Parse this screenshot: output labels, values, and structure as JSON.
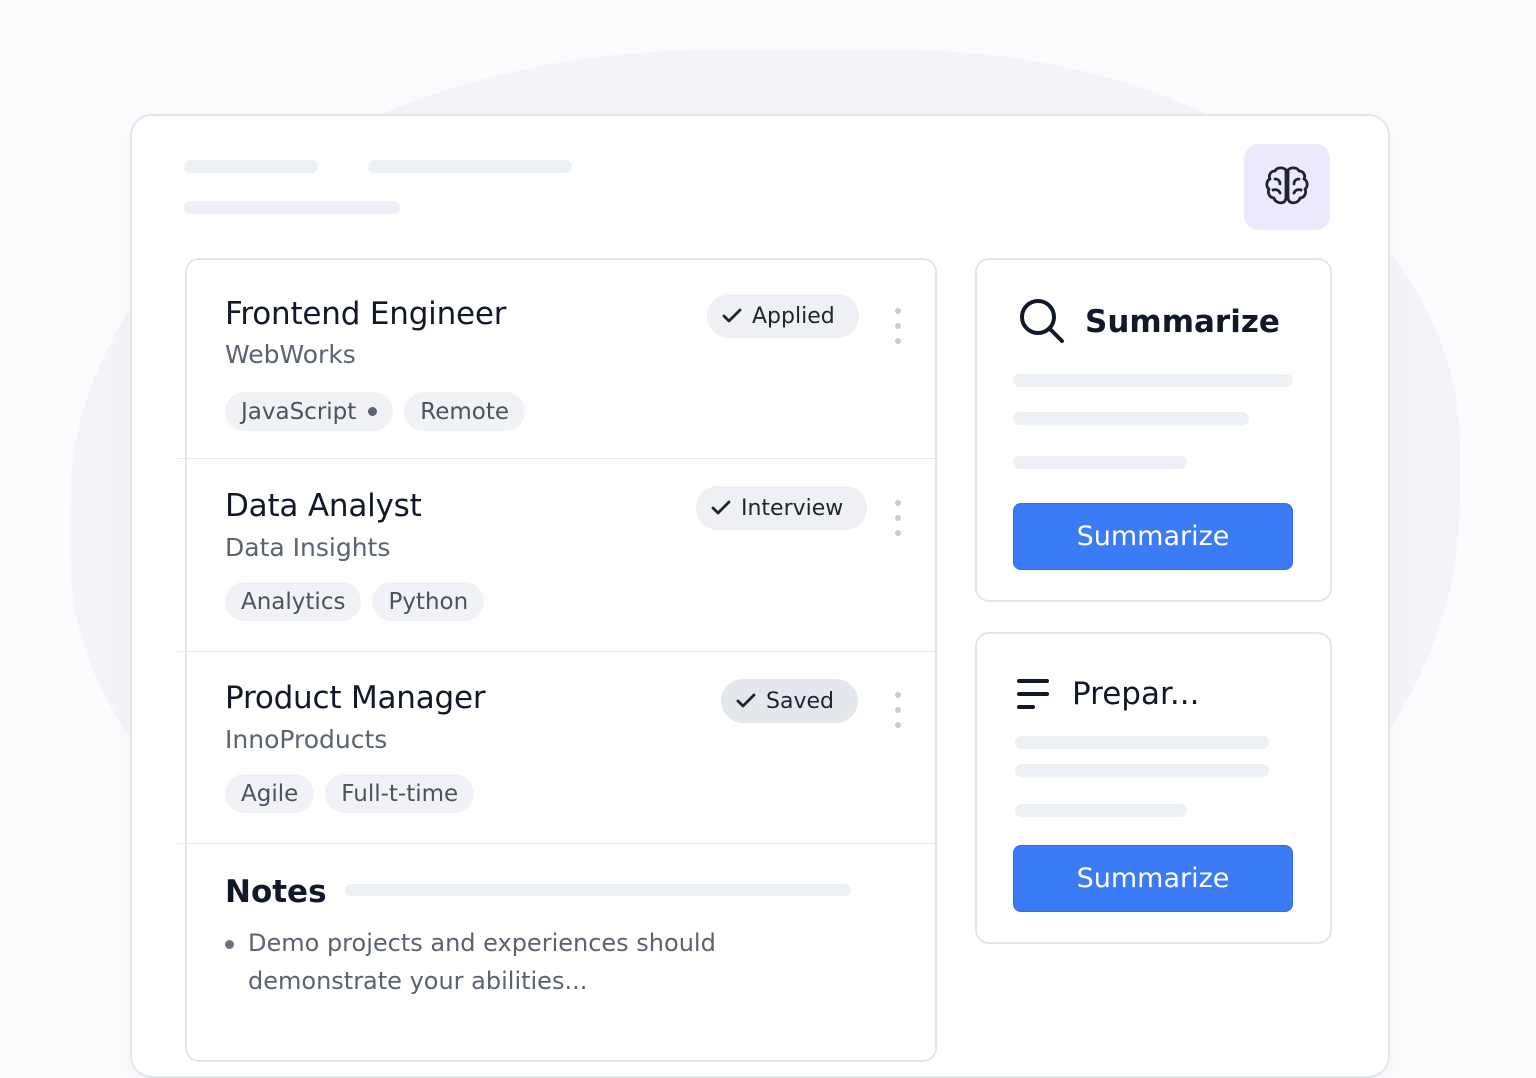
{
  "header": {
    "ai_button_icon": "brain-icon"
  },
  "jobs": [
    {
      "title": "Frontend Engineer",
      "company": "WebWorks",
      "status": "Applied",
      "status_icon": "check-icon",
      "tags": [
        "JavaScript",
        "Remote"
      ]
    },
    {
      "title": "Data Analyst",
      "company": "Data Insights",
      "status": "Interview",
      "status_icon": "check-icon",
      "tags": [
        "Analytics",
        "Python"
      ]
    },
    {
      "title": "Product Manager",
      "company": "InnoProducts",
      "status": "Saved",
      "status_icon": "check-icon",
      "tags": [
        "Agile",
        "Full-t-time"
      ]
    }
  ],
  "notes": {
    "title": "Notes",
    "items": [
      "Demo projects and experiences should demonstrate your abilities..."
    ]
  },
  "summarize_card": {
    "icon": "search-icon",
    "title": "Summarize",
    "button_label": "Summarize"
  },
  "prepare_card": {
    "icon": "menu-lines-icon",
    "title": "Prepar...",
    "button_label": "Summarize"
  },
  "colors": {
    "accent": "#3b7bf5",
    "ai_button_bg": "#ede9fc",
    "tag_bg": "#f0f2f5",
    "skeleton": "#edf0f4"
  }
}
